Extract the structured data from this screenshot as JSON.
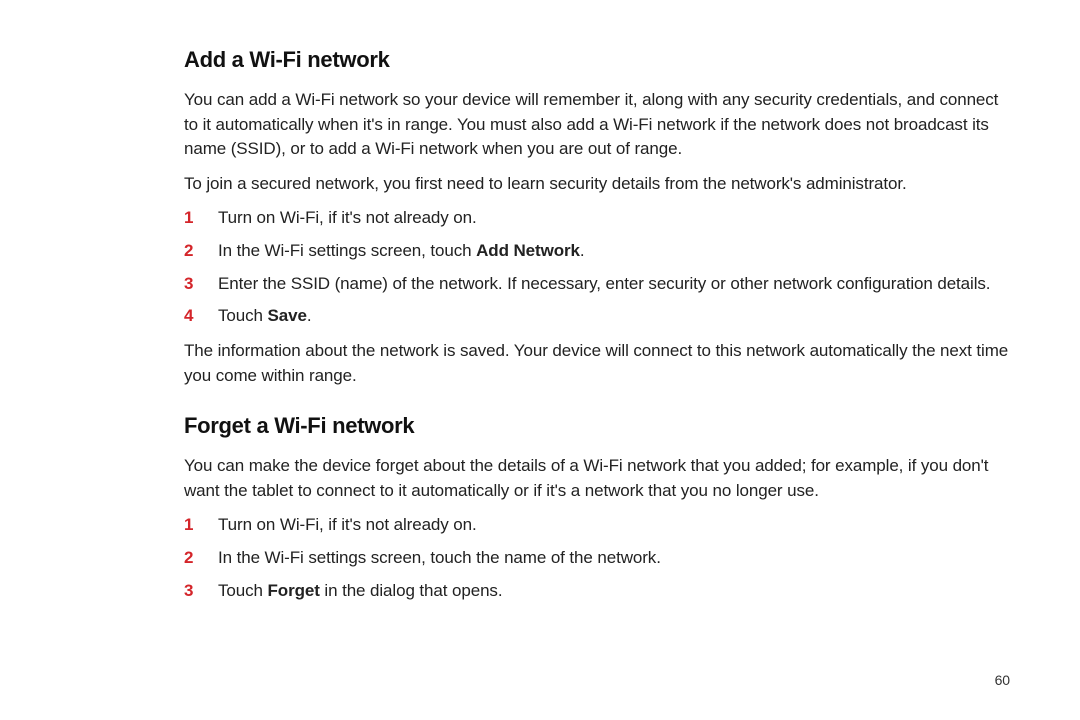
{
  "page_number": "60",
  "add": {
    "heading": "Add a Wi-Fi network",
    "intro": "You can add a Wi-Fi network so your device will remember it, along with any security credentials, and connect to it automatically when it's in range. You must also add a Wi-Fi network if the network does not broadcast its name (SSID), or to add a Wi-Fi network when you are out of range.",
    "secured_note": "To join a secured network, you first need to learn security details from the network's administrator.",
    "step_num_1": "1",
    "step1": "Turn on Wi-Fi, if it's not already on.",
    "step_num_2": "2",
    "step2_pre": "In the Wi-Fi settings screen, touch ",
    "step2_bold": "Add Network",
    "step2_post": ".",
    "step_num_3": "3",
    "step3": "Enter the SSID (name) of the network. If necessary, enter security or other network configuration details.",
    "step_num_4": "4",
    "step4_pre": "Touch ",
    "step4_bold": "Save",
    "step4_post": ".",
    "outro": "The information about the network is saved. Your device will connect to this network automatically the next time you come within range."
  },
  "forget": {
    "heading": "Forget a Wi-Fi network",
    "intro": "You can make the device forget about the details of a Wi-Fi network that you added; for example, if you don't want the tablet to connect to it automatically or if it's a network that you no longer use.",
    "step_num_1": "1",
    "step1": "Turn on Wi-Fi, if it's not already on.",
    "step_num_2": "2",
    "step2": "In the Wi-Fi settings screen, touch the name of the network.",
    "step_num_3": "3",
    "step3_pre": "Touch ",
    "step3_bold": "Forget",
    "step3_post": " in the dialog that opens."
  }
}
